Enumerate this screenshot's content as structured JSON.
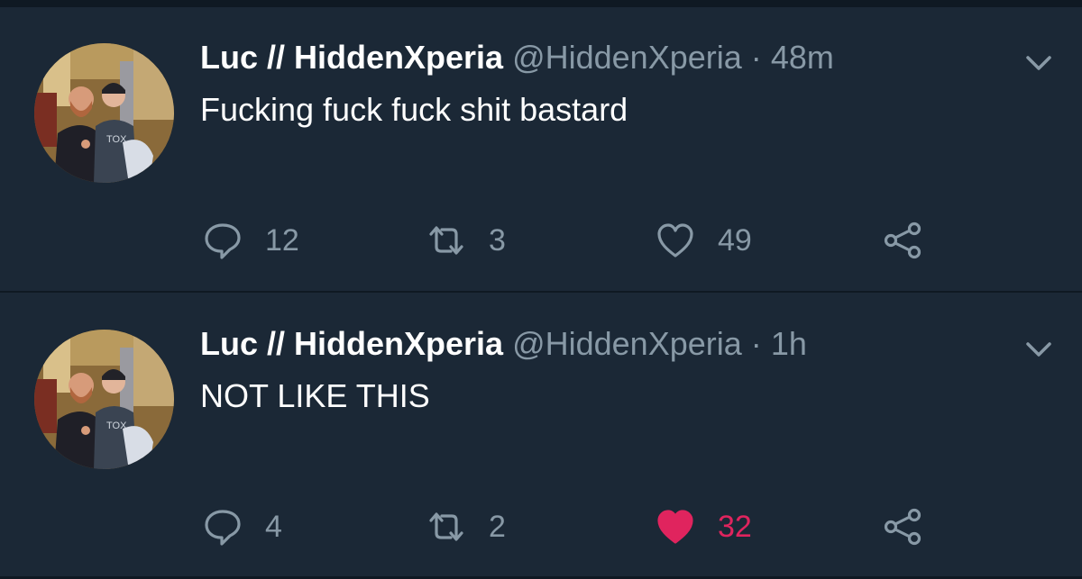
{
  "colors": {
    "background": "#1b2836",
    "divider": "#0f1923",
    "secondary_text": "#8899a6",
    "primary_text": "#ffffff",
    "like_active": "#e0245e"
  },
  "tweets": [
    {
      "name": "Luc // HiddenXperia",
      "handle": "@HiddenXperia",
      "separator": "·",
      "time": "48m",
      "text": "Fucking fuck fuck shit bastard",
      "replies": "12",
      "retweets": "3",
      "likes": "49",
      "liked": false
    },
    {
      "name": "Luc // HiddenXperia",
      "handle": "@HiddenXperia",
      "separator": "·",
      "time": "1h",
      "text": "NOT LIKE THIS",
      "replies": "4",
      "retweets": "2",
      "likes": "32",
      "liked": true
    }
  ],
  "icons": {
    "reply": "reply-icon",
    "retweet": "retweet-icon",
    "like": "heart-icon",
    "share": "share-icon",
    "menu": "chevron-down-icon",
    "avatar_shirt_text": "TOX"
  }
}
